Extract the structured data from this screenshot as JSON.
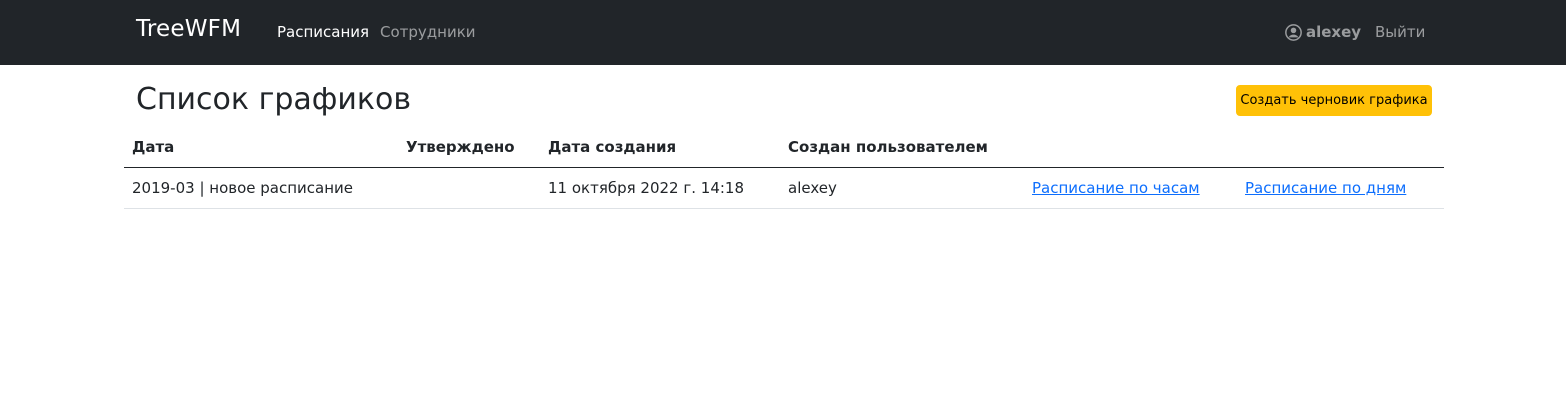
{
  "navbar": {
    "brand": "TreeWFM",
    "links": [
      {
        "label": "Расписания",
        "active": true
      },
      {
        "label": "Сотрудники",
        "active": false
      }
    ],
    "user": {
      "icon": "user-circle-icon",
      "name": "alexey"
    },
    "logout_label": "Выйти"
  },
  "page": {
    "title": "Список графиков",
    "create_button_label": "Создать черновик графика"
  },
  "table": {
    "headers": [
      "Дата",
      "Утверждено",
      "Дата создания",
      "Создан пользователем"
    ],
    "rows": [
      {
        "date": "2019-03 | новое расписание",
        "approved": "",
        "created_at": "11 октября 2022 г. 14:18",
        "created_by": "alexey",
        "hourly_link": "Расписание по часам",
        "daily_link": "Расписание по дням"
      }
    ]
  },
  "colors": {
    "navbar_bg": "#212529",
    "primary_button": "#ffc107",
    "link": "#0d6efd"
  }
}
